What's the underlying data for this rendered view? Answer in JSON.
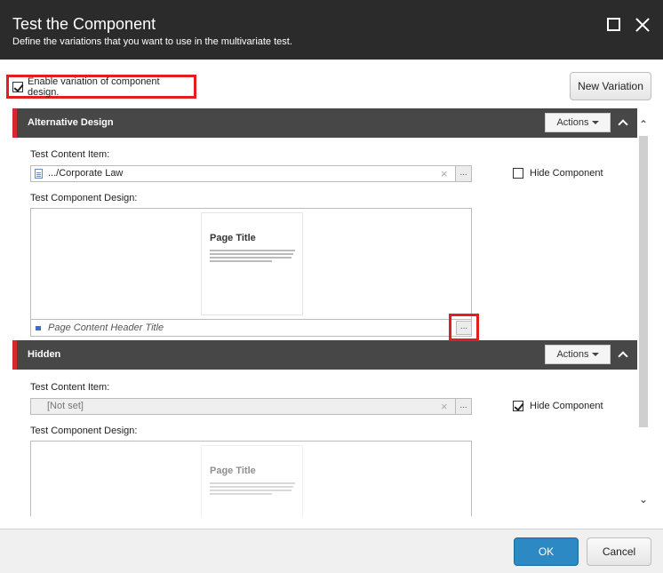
{
  "dialog": {
    "title": "Test the Component",
    "subtitle": "Define the variations that you want to use in the multivariate test.",
    "maximize_icon": "maximize-icon",
    "close_icon": "close-icon"
  },
  "toolbar": {
    "enable_label": "Enable variation of component design.",
    "enable_checked": true,
    "new_variation_label": "New Variation"
  },
  "variations": [
    {
      "name": "Alternative Design",
      "actions_label": "Actions",
      "test_content_item_label": "Test Content Item:",
      "test_content_item_value": ".../Corporate Law",
      "hide_component_label": "Hide Component",
      "hide_component_checked": false,
      "test_component_design_label": "Test Component Design:",
      "preview_title": "Page Title",
      "design_value": "Page Content Header Title",
      "browse_label": "..."
    },
    {
      "name": "Hidden",
      "actions_label": "Actions",
      "test_content_item_label": "Test Content Item:",
      "test_content_item_value": "[Not set]",
      "hide_component_label": "Hide Component",
      "hide_component_checked": true,
      "test_component_design_label": "Test Component Design:",
      "preview_title": "Page Title",
      "browse_label": "..."
    }
  ],
  "clear_glyph": "×",
  "footer": {
    "ok_label": "OK",
    "cancel_label": "Cancel"
  },
  "colors": {
    "header_bg": "#2b2b2b",
    "section_bg": "#474747",
    "section_accent": "#d8282f",
    "highlight": "#e02020",
    "ok_button": "#2d89c3"
  }
}
